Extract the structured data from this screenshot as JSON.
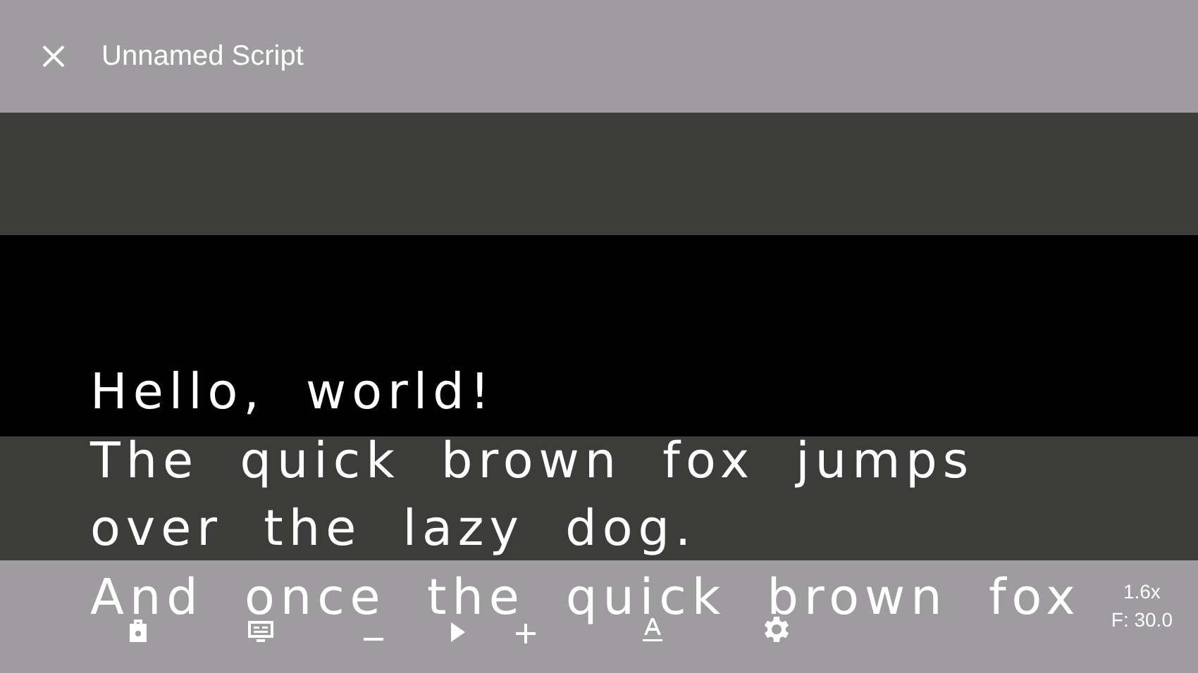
{
  "window": {
    "title": "Unnamed Script"
  },
  "script_lines": [
    "Hello, world!",
    "The quick brown fox jumps",
    "over the lazy dog.",
    "And once the quick brown fox"
  ],
  "toolbar": {
    "speed": "1.6x",
    "font_size": "F: 30.0"
  }
}
